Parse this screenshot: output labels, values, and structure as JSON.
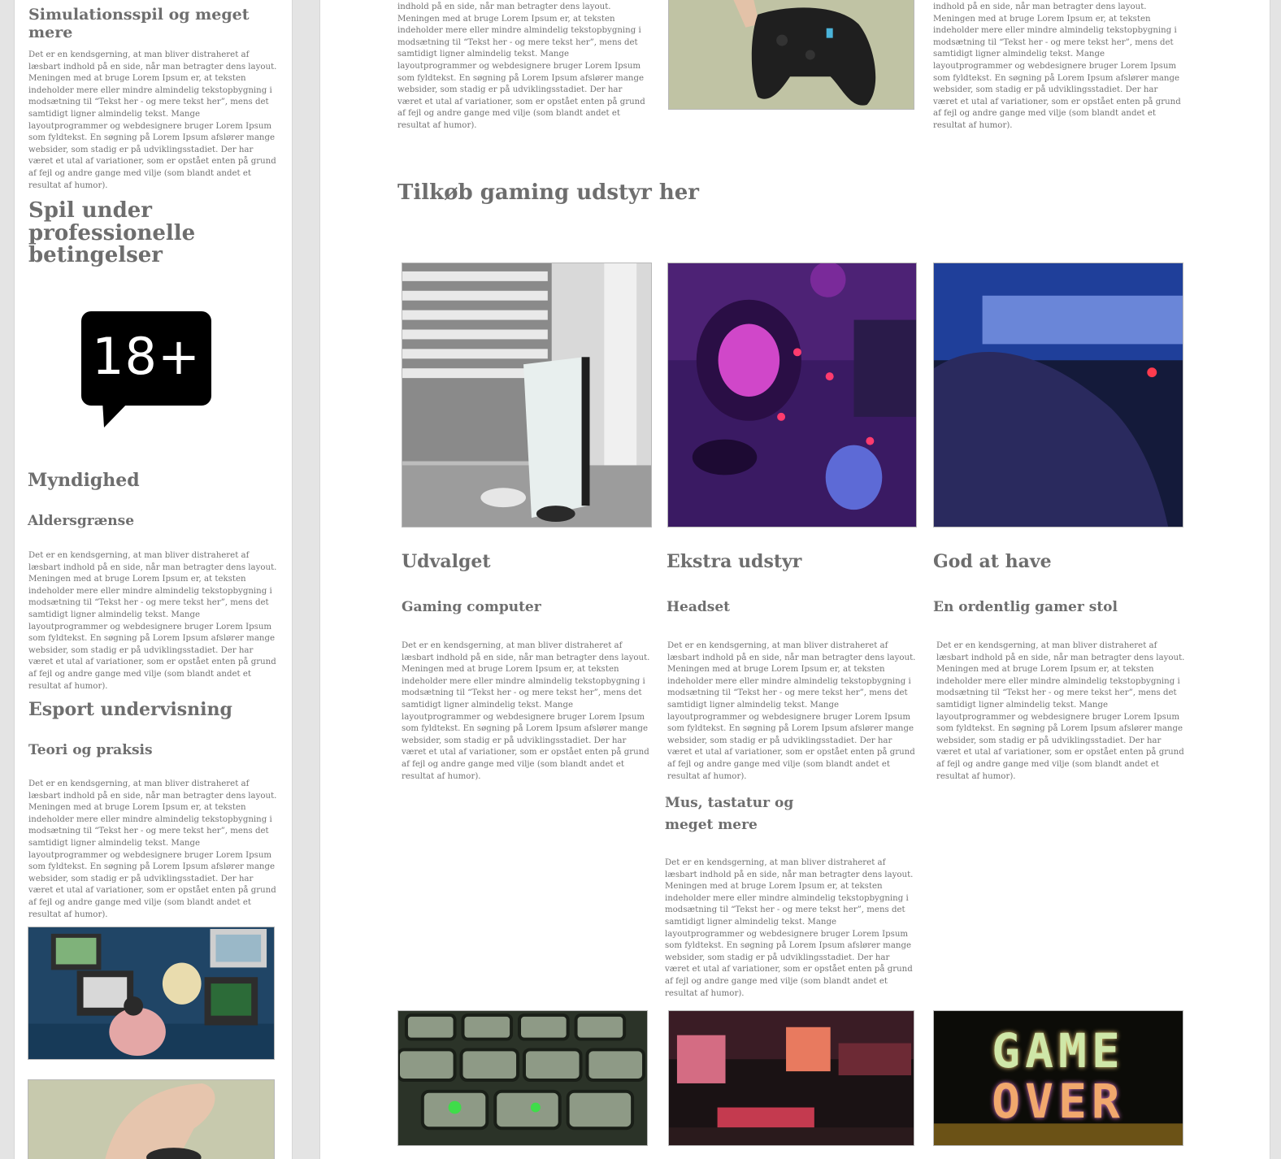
{
  "lorem": "Det er en kendsgerning, at man bliver distraheret af læsbart indhold på en side, når man betragter dens layout. Meningen med at bruge Lorem Ipsum er, at teksten indeholder mere eller mindre almindelig tekstopbygning i modsætning til “Tekst her - og mere tekst her”, mens det samtidigt ligner almindelig tekst. Mange layoutprogrammer og webdesignere bruger Lorem Ipsum som fyldtekst. En søgning på Lorem Ipsum afslører mange websider, som stadig er på udviklingsstadiet. Der har været et utal af variationer, som er opstået enten på grund af fejl og andre gange med vilje (som blandt andet et resultat af humor).",
  "lorem_cut": "indhold på en side, når man betragter dens layout. Meningen med at bruge Lorem Ipsum er, at teksten indeholder mere eller mindre almindelig tekstopbygning i modsætning til “Tekst her - og mere tekst her”, mens det samtidigt ligner almindelig tekst. Mange layoutprogrammer og webdesignere bruger Lorem Ipsum som fyldtekst. En søgning på Lorem Ipsum afslører mange websider, som stadig er på udviklingsstadiet. Der har været et utal af variationer, som er opstået enten på grund af fejl og andre gange med vilje (som blandt andet et resultat af humor).",
  "sidebar": {
    "heading_simulation": "Simulationsspil og meget mere",
    "heading_professional": "Spil under professionelle betingelser",
    "age_badge": "18+",
    "heading_authority": "Myndighed",
    "sub_age_limit": "Aldersgrænse",
    "heading_esport": "Esport undervisning",
    "sub_theory": "Teori og praksis"
  },
  "main": {
    "shop_heading": "Tilkøb gaming udstyr her",
    "columns": [
      {
        "title": "Udvalget",
        "subtitle": "Gaming computer"
      },
      {
        "title": "Ekstra udstyr",
        "subtitle": "Headset"
      },
      {
        "title": "God at have",
        "subtitle": "En ordentlig gamer stol"
      }
    ],
    "extra_sub": "Mus, tastatur og meget mere",
    "gameover_line1": "GAME",
    "gameover_line2": "OVER"
  },
  "colors": {
    "page_bg": "#e4e4e4",
    "panel_bg": "#ffffff",
    "heading_text": "#6e6e6e",
    "body_text": "#727272"
  }
}
